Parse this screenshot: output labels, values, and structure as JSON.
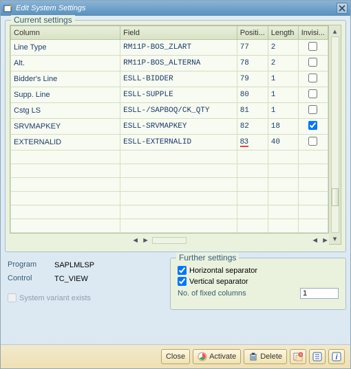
{
  "window": {
    "title": "Edit System Settings"
  },
  "currentSettingsLabel": "Current settings",
  "columns": {
    "col": "Column",
    "field": "Field",
    "pos": "Positi...",
    "len": "Length",
    "invis": "Invisi..."
  },
  "rows": [
    {
      "col": "Line Type",
      "field": "RM11P-BOS_ZLART",
      "pos": "77",
      "len": "2",
      "invis": false
    },
    {
      "col": "Alt.",
      "field": "RM11P-BOS_ALTERNA",
      "pos": "78",
      "len": "2",
      "invis": false
    },
    {
      "col": "Bidder's Line",
      "field": "ESLL-BIDDER",
      "pos": "79",
      "len": "1",
      "invis": false
    },
    {
      "col": "Supp. Line",
      "field": "ESLL-SUPPLE",
      "pos": "80",
      "len": "1",
      "invis": false
    },
    {
      "col": "Cstg LS",
      "field": "ESLL-/SAPBOQ/CK_QTY",
      "pos": "81",
      "len": "1",
      "invis": false
    },
    {
      "col": "SRVMAPKEY",
      "field": "ESLL-SRVMAPKEY",
      "pos": "82",
      "len": "18",
      "invis": true
    },
    {
      "col": "EXTERNALID",
      "field": "ESLL-EXTERNALID",
      "pos": "83",
      "len": "40",
      "invis": false
    }
  ],
  "info": {
    "programLabel": "Program",
    "programValue": "SAPLMLSP",
    "controlLabel": "Control",
    "controlValue": "TC_VIEW",
    "sysVariantLabel": "System variant exists"
  },
  "further": {
    "legend": "Further settings",
    "hsep": "Horizontal separator",
    "vsep": "Vertical separator",
    "fixedLabel": "No. of fixed columns",
    "fixedValue": "1",
    "hsepChecked": true,
    "vsepChecked": true
  },
  "buttons": {
    "close": "Close",
    "activate": "Activate",
    "delete": "Delete"
  }
}
